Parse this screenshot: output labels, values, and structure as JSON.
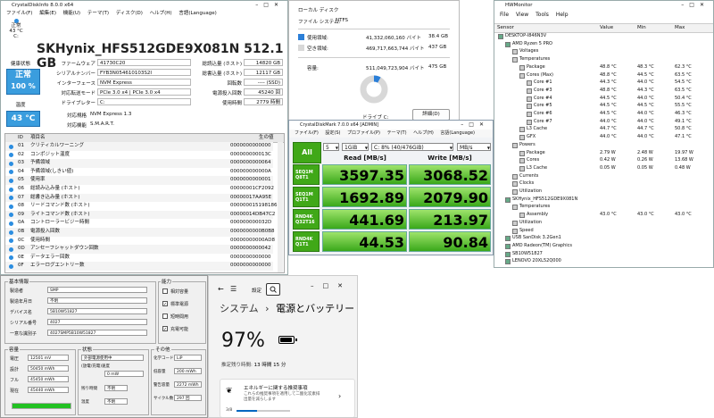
{
  "cdi": {
    "title": "CrystalDiskInfo 8.0.0 x64",
    "menu": [
      "ファイル(F)",
      "編集(E)",
      "機能(U)",
      "テーマ(T)",
      "ディスク(D)",
      "ヘルプ(H)",
      "言語(Language)"
    ],
    "drive_status": "正常",
    "drive_temp": "43 °C",
    "drive_letter": "C:",
    "model": "SKHynix_HFS512GDE9X081N 512.1 GB",
    "health_label": "健康状態",
    "health_status": "正常",
    "health_pct": "100 %",
    "temp_label": "温度",
    "temp_value": "43 °C",
    "labels_left": [
      "ファームウェア",
      "シリアルナンバー",
      "インターフェース",
      "対応転送モード",
      "ドライブレター"
    ],
    "values_left": [
      "41730C20",
      "FYB3N054610103S2I",
      "NVM Express",
      "PCIe 3.0 x4 | PCIe 3.0 x4",
      "C:"
    ],
    "labels_right": [
      "総読込量 (ホスト)",
      "総書込量 (ホスト)",
      "回転数",
      "電源投入回数",
      "使用時間"
    ],
    "values_right": [
      "14820 GB",
      "12117 GB",
      "---- (SSD)",
      "45240 回",
      "2779 時間"
    ],
    "std_label": "対応規格",
    "std_value": "NVM Express 1.3",
    "feat_label": "対応機能",
    "feat_value": "S.M.A.R.T.",
    "smart_headers": [
      "ID",
      "項目名",
      "生の値"
    ],
    "smart_rows": [
      {
        "id": "01",
        "name": "クリティカルワーニング",
        "raw": "0000000000000"
      },
      {
        "id": "02",
        "name": "コンポジット温度",
        "raw": "000000000013C"
      },
      {
        "id": "03",
        "name": "予備領域",
        "raw": "0000000000064"
      },
      {
        "id": "04",
        "name": "予備領域(しきい値)",
        "raw": "000000000000A"
      },
      {
        "id": "05",
        "name": "使用率",
        "raw": "0000000000001"
      },
      {
        "id": "06",
        "name": "総読み込み量 (ホスト)",
        "raw": "00000001CF2092"
      },
      {
        "id": "07",
        "name": "総書き込み量 (ホスト)",
        "raw": "00000017AA95E"
      },
      {
        "id": "08",
        "name": "リードコマンド数 (ホスト)",
        "raw": "000000015198186"
      },
      {
        "id": "09",
        "name": "ライトコマンド数 (ホスト)",
        "raw": "00000014DB47C2"
      },
      {
        "id": "0A",
        "name": "コントローラービジー時間",
        "raw": "000000000032D"
      },
      {
        "id": "0B",
        "name": "電源投入回数",
        "raw": "0000000000B0B8"
      },
      {
        "id": "0C",
        "name": "使用時間",
        "raw": "00000000000AD8"
      },
      {
        "id": "0D",
        "name": "アンセーフシャットダウン回数",
        "raw": "0000000000042"
      },
      {
        "id": "0E",
        "name": "データエラー回数",
        "raw": "0000000000000"
      },
      {
        "id": "0F",
        "name": "エラーログエントリー数",
        "raw": "0000000000000"
      }
    ]
  },
  "props": {
    "type_label": "ファイル システム:",
    "type_value": "NTFS",
    "disk_label": "ローカル ディスク",
    "used_label": "使用領域:",
    "used_bytes": "41,332,060,160 バイト",
    "used_gb": "38.4 GB",
    "free_label": "空き領域:",
    "free_bytes": "469,717,663,744 バイト",
    "free_gb": "437 GB",
    "cap_label": "容量:",
    "cap_bytes": "511,049,723,904 バイト",
    "cap_gb": "475 GB",
    "drive_caption": "ドライブ C:",
    "detail_button": "詳細(D)",
    "used_fraction": 0.081,
    "used_color": "#2b7fd8",
    "free_color": "#d8d8d8"
  },
  "cdm": {
    "title": "CrystalDiskMark 7.0.0 x64 [ADMIN]",
    "menu": [
      "ファイル(F)",
      "設定(S)",
      "プロファイル(P)",
      "テーマ(T)",
      "ヘルプ(H)",
      "言語(Language)"
    ],
    "all_button": "All",
    "count": "5",
    "size": "1GiB",
    "drive": "C: 8% (40/476GiB)",
    "unit": "MB/s",
    "read_header": "Read [MB/s]",
    "write_header": "Write [MB/s]",
    "tests": [
      {
        "l1": "SEQ1M",
        "l2": "Q8T1",
        "read": "3597.35",
        "write": "3068.52"
      },
      {
        "l1": "SEQ1M",
        "l2": "Q1T1",
        "read": "1692.89",
        "write": "2079.90"
      },
      {
        "l1": "RND4K",
        "l2": "Q32T16",
        "read": "441.69",
        "write": "213.97"
      },
      {
        "l1": "RND4K",
        "l2": "Q1T1",
        "read": "44.53",
        "write": "90.84"
      }
    ]
  },
  "hwm": {
    "title": "HWMonitor",
    "menu": [
      "File",
      "View",
      "Tools",
      "Help"
    ],
    "headers": [
      "Sensor",
      "Value",
      "Min",
      "Max"
    ],
    "rows": [
      {
        "ind": 0,
        "name": "DESKTOP-I846N3V",
        "v": "",
        "mn": "",
        "mx": ""
      },
      {
        "ind": 1,
        "name": "AMD Ryzen 5 PRO",
        "v": "",
        "mn": "",
        "mx": ""
      },
      {
        "ind": 2,
        "name": "Voltages",
        "v": "",
        "mn": "",
        "mx": ""
      },
      {
        "ind": 2,
        "name": "Temperatures",
        "v": "",
        "mn": "",
        "mx": ""
      },
      {
        "ind": 3,
        "name": "Package",
        "v": "48.8 °C",
        "mn": "48.3 °C",
        "mx": "62.3 °C"
      },
      {
        "ind": 3,
        "name": "Cores (Max)",
        "v": "48.8 °C",
        "mn": "44.5 °C",
        "mx": "63.5 °C"
      },
      {
        "ind": 4,
        "name": "Core #1",
        "v": "44.3 °C",
        "mn": "44.0 °C",
        "mx": "54.5 °C"
      },
      {
        "ind": 4,
        "name": "Core #3",
        "v": "48.8 °C",
        "mn": "44.3 °C",
        "mx": "63.5 °C"
      },
      {
        "ind": 4,
        "name": "Core #4",
        "v": "44.5 °C",
        "mn": "44.0 °C",
        "mx": "50.4 °C"
      },
      {
        "ind": 4,
        "name": "Core #5",
        "v": "44.5 °C",
        "mn": "44.5 °C",
        "mx": "55.5 °C"
      },
      {
        "ind": 4,
        "name": "Core #6",
        "v": "44.5 °C",
        "mn": "44.0 °C",
        "mx": "46.3 °C"
      },
      {
        "ind": 4,
        "name": "Core #7",
        "v": "44.0 °C",
        "mn": "44.0 °C",
        "mx": "49.1 °C"
      },
      {
        "ind": 3,
        "name": "L3 Cache",
        "v": "44.7 °C",
        "mn": "44.7 °C",
        "mx": "50.8 °C"
      },
      {
        "ind": 3,
        "name": "GFX",
        "v": "44.0 °C",
        "mn": "44.0 °C",
        "mx": "47.1 °C"
      },
      {
        "ind": 2,
        "name": "Powers",
        "v": "",
        "mn": "",
        "mx": ""
      },
      {
        "ind": 3,
        "name": "Package",
        "v": "2.79 W",
        "mn": "2.48 W",
        "mx": "19.97 W"
      },
      {
        "ind": 3,
        "name": "Cores",
        "v": "0.42 W",
        "mn": "0.26 W",
        "mx": "13.68 W"
      },
      {
        "ind": 3,
        "name": "L3 Cache",
        "v": "0.05 W",
        "mn": "0.05 W",
        "mx": "0.48 W"
      },
      {
        "ind": 2,
        "name": "Currents",
        "v": "",
        "mn": "",
        "mx": ""
      },
      {
        "ind": 2,
        "name": "Clocks",
        "v": "",
        "mn": "",
        "mx": ""
      },
      {
        "ind": 2,
        "name": "Utilization",
        "v": "",
        "mn": "",
        "mx": ""
      },
      {
        "ind": 1,
        "name": "SKHynix_HFS512GDE9X081N",
        "v": "",
        "mn": "",
        "mx": ""
      },
      {
        "ind": 2,
        "name": "Temperatures",
        "v": "",
        "mn": "",
        "mx": ""
      },
      {
        "ind": 3,
        "name": "Assembly",
        "v": "43.0 °C",
        "mn": "43.0 °C",
        "mx": "43.0 °C"
      },
      {
        "ind": 2,
        "name": "Utilization",
        "v": "",
        "mn": "",
        "mx": ""
      },
      {
        "ind": 2,
        "name": "Speed",
        "v": "",
        "mn": "",
        "mx": ""
      },
      {
        "ind": 1,
        "name": "USB  SanDisk 3.2Gen1",
        "v": "",
        "mn": "",
        "mx": ""
      },
      {
        "ind": 1,
        "name": "AMD Radeon(TM) Graphics",
        "v": "",
        "mn": "",
        "mx": ""
      },
      {
        "ind": 1,
        "name": "SB10W51827",
        "v": "",
        "mn": "",
        "mx": ""
      },
      {
        "ind": 1,
        "name": "LENOVO 20XL52Q000",
        "v": "",
        "mn": "",
        "mx": ""
      }
    ]
  },
  "bat": {
    "basic_label": "基本情報",
    "fields": [
      {
        "k": "製造者",
        "v": "SMP"
      },
      {
        "k": "製造年月日",
        "v": "不明"
      },
      {
        "k": "デバイス名",
        "v": "5B10W51827"
      },
      {
        "k": "シリアル番号",
        "v": "4027"
      },
      {
        "k": "一意な識別子",
        "v": "4027SMP5B10W51827"
      }
    ],
    "ability_label": "能力",
    "abilities": [
      {
        "mark": "",
        "t": "相対容量"
      },
      {
        "mark": "✓",
        "t": "標準電源"
      },
      {
        "mark": "",
        "t": "短時間用"
      },
      {
        "mark": "✓",
        "t": "充電可能"
      }
    ],
    "cap_label": "容量",
    "caps": [
      {
        "k": "電圧",
        "v": "12501 mV"
      },
      {
        "k": "設計",
        "v": "50450 mWh"
      },
      {
        "k": "フル",
        "v": "45450 mWh"
      },
      {
        "k": "現在",
        "v": "45440 mWh"
      }
    ],
    "status_label": "状態",
    "status_power": "外部電源使用中",
    "status_rate_label": "(放電/充電)速度",
    "status_rate": "0 mW",
    "status_est_label": "残り時間",
    "status_est": "不明",
    "status_temp_label": "温度",
    "status_temp": "不明",
    "other_label": "その他",
    "others": [
      {
        "k": "化学コード",
        "v": "LiP"
      },
      {
        "k": "低容量",
        "v": "200 mWh"
      },
      {
        "k": "警告容量",
        "v": "2272 mWh"
      },
      {
        "k": "サイクル数",
        "v": "297 回"
      }
    ],
    "charge_fraction": 1.0
  },
  "ws": {
    "settings_label": "設定",
    "crumb_parent": "システム",
    "crumb_sep": "›",
    "crumb_current": "電源とバッテリー",
    "pct": "97%",
    "remaining_label": "推定残り時間:",
    "remaining_value": "13 時間 15 分",
    "card_title": "エネルギーに関する推奨事項",
    "card_body": "これらの推奨事項を適用して二酸化炭素排出量を減らします",
    "card_progress_text": "3/8",
    "card_progress": 0.375,
    "battery_level": 0.97
  }
}
